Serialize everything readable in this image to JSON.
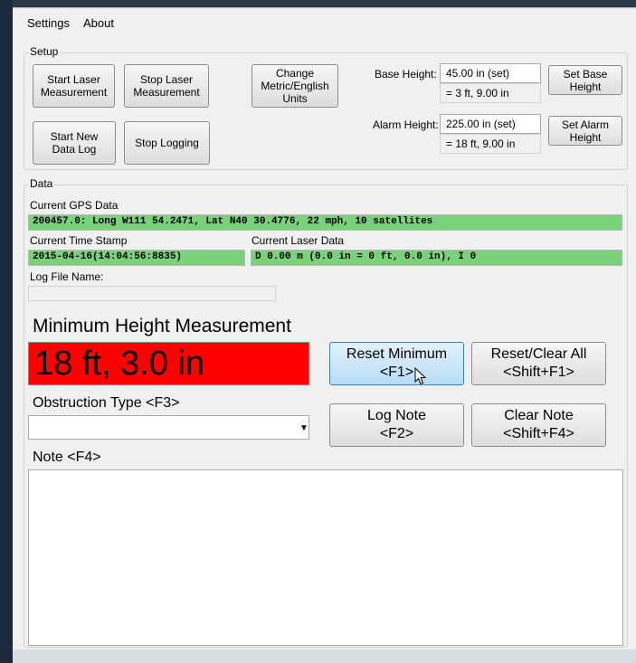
{
  "menu": {
    "settings": "Settings",
    "about": "About"
  },
  "setup": {
    "title": "Setup",
    "start_laser": "Start Laser Measurement",
    "stop_laser": "Stop Laser Measurement",
    "change_units": "Change Metric/English Units",
    "start_log": "Start New Data Log",
    "stop_log": "Stop Logging",
    "base_height_label": "Base Height:",
    "base_height_value": "45.00 in (set)",
    "base_height_converted": "= 3 ft, 9.00 in",
    "set_base": "Set Base Height",
    "alarm_height_label": "Alarm Height:",
    "alarm_height_value": "225.00 in (set)",
    "alarm_height_converted": "= 18 ft, 9.00 in",
    "set_alarm": "Set Alarm Height"
  },
  "data": {
    "title": "Data",
    "gps_label": "Current GPS Data",
    "gps_value": "200457.0: Long W111 54.2471, Lat N40 30.4776, 22 mph, 10 satellites",
    "time_label": "Current Time Stamp",
    "time_value": "2015-04-16(14:04:56:8835)",
    "laser_label": "Current Laser Data",
    "laser_value": "D 0.00 m (0.0 in = 0 ft, 0.0 in), I 0",
    "logfile_label": "Log File Name:",
    "logfile_value": ""
  },
  "min_height": {
    "title": "Minimum Height Measurement",
    "value": "18 ft, 3.0 in"
  },
  "buttons": {
    "reset_min_1": "Reset Minimum",
    "reset_min_2": "<F1>",
    "reset_all_1": "Reset/Clear All",
    "reset_all_2": "<Shift+F1>",
    "log_note_1": "Log Note",
    "log_note_2": "<F2>",
    "clear_note_1": "Clear Note",
    "clear_note_2": "<Shift+F4>"
  },
  "obstruction": {
    "label": "Obstruction Type <F3>",
    "selected": ""
  },
  "note": {
    "label": "Note <F4>",
    "value": ""
  },
  "colors": {
    "alarm_red": "#ff0000",
    "status_green": "#79d279"
  }
}
